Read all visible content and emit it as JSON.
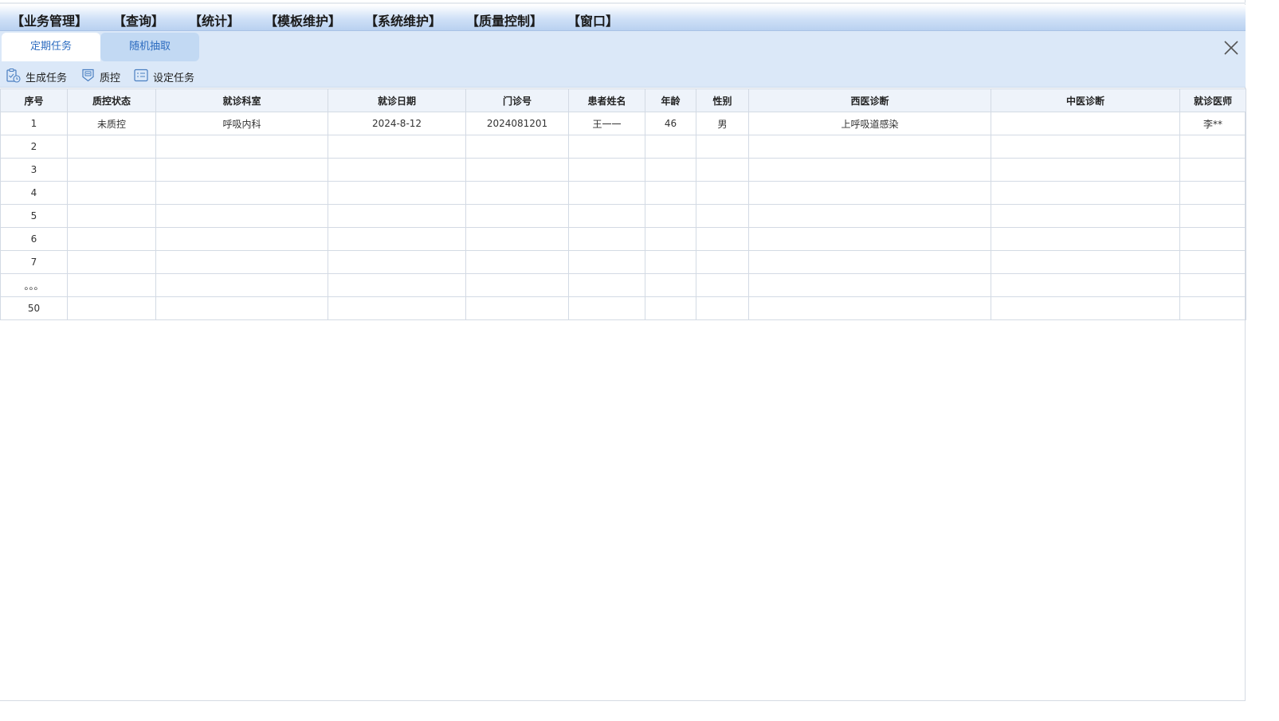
{
  "menu": [
    "【业务管理】",
    "【查询】",
    "【统计】",
    "【模板维护】",
    "【系统维护】",
    "【质量控制】",
    "【窗口】"
  ],
  "tabs": [
    {
      "label": "定期任务",
      "active": true
    },
    {
      "label": "随机抽取",
      "active": false
    }
  ],
  "toolbar": {
    "generate_label": "生成任务",
    "qc_label": "质控",
    "set_label": "设定任务"
  },
  "table": {
    "columns": [
      "序号",
      "质控状态",
      "就诊科室",
      "就诊日期",
      "门诊号",
      "患者姓名",
      "年龄",
      "性别",
      "西医诊断",
      "中医诊断",
      "就诊医师"
    ],
    "rows": [
      [
        "1",
        "未质控",
        "呼吸内科",
        "2024-8-12",
        "2024081201",
        "王一一",
        "46",
        "男",
        "上呼吸道感染",
        "",
        "李**"
      ],
      [
        "2",
        "",
        "",
        "",
        "",
        "",
        "",
        "",
        "",
        "",
        ""
      ],
      [
        "3",
        "",
        "",
        "",
        "",
        "",
        "",
        "",
        "",
        "",
        ""
      ],
      [
        "4",
        "",
        "",
        "",
        "",
        "",
        "",
        "",
        "",
        "",
        ""
      ],
      [
        "5",
        "",
        "",
        "",
        "",
        "",
        "",
        "",
        "",
        "",
        ""
      ],
      [
        "6",
        "",
        "",
        "",
        "",
        "",
        "",
        "",
        "",
        "",
        ""
      ],
      [
        "7",
        "",
        "",
        "",
        "",
        "",
        "",
        "",
        "",
        "",
        ""
      ],
      [
        "。。。",
        "",
        "",
        "",
        "",
        "",
        "",
        "",
        "",
        "",
        ""
      ],
      [
        "50",
        "",
        "",
        "",
        "",
        "",
        "",
        "",
        "",
        "",
        ""
      ]
    ]
  },
  "colors": {
    "accent": "#2d6cc0",
    "tab_bg": "#dbe8f8",
    "header_bg": "#eef3fa"
  },
  "icons": {
    "generate": "clipboard-clock-icon",
    "qc": "badge-icon",
    "set": "list-icon",
    "close": "close-icon"
  }
}
